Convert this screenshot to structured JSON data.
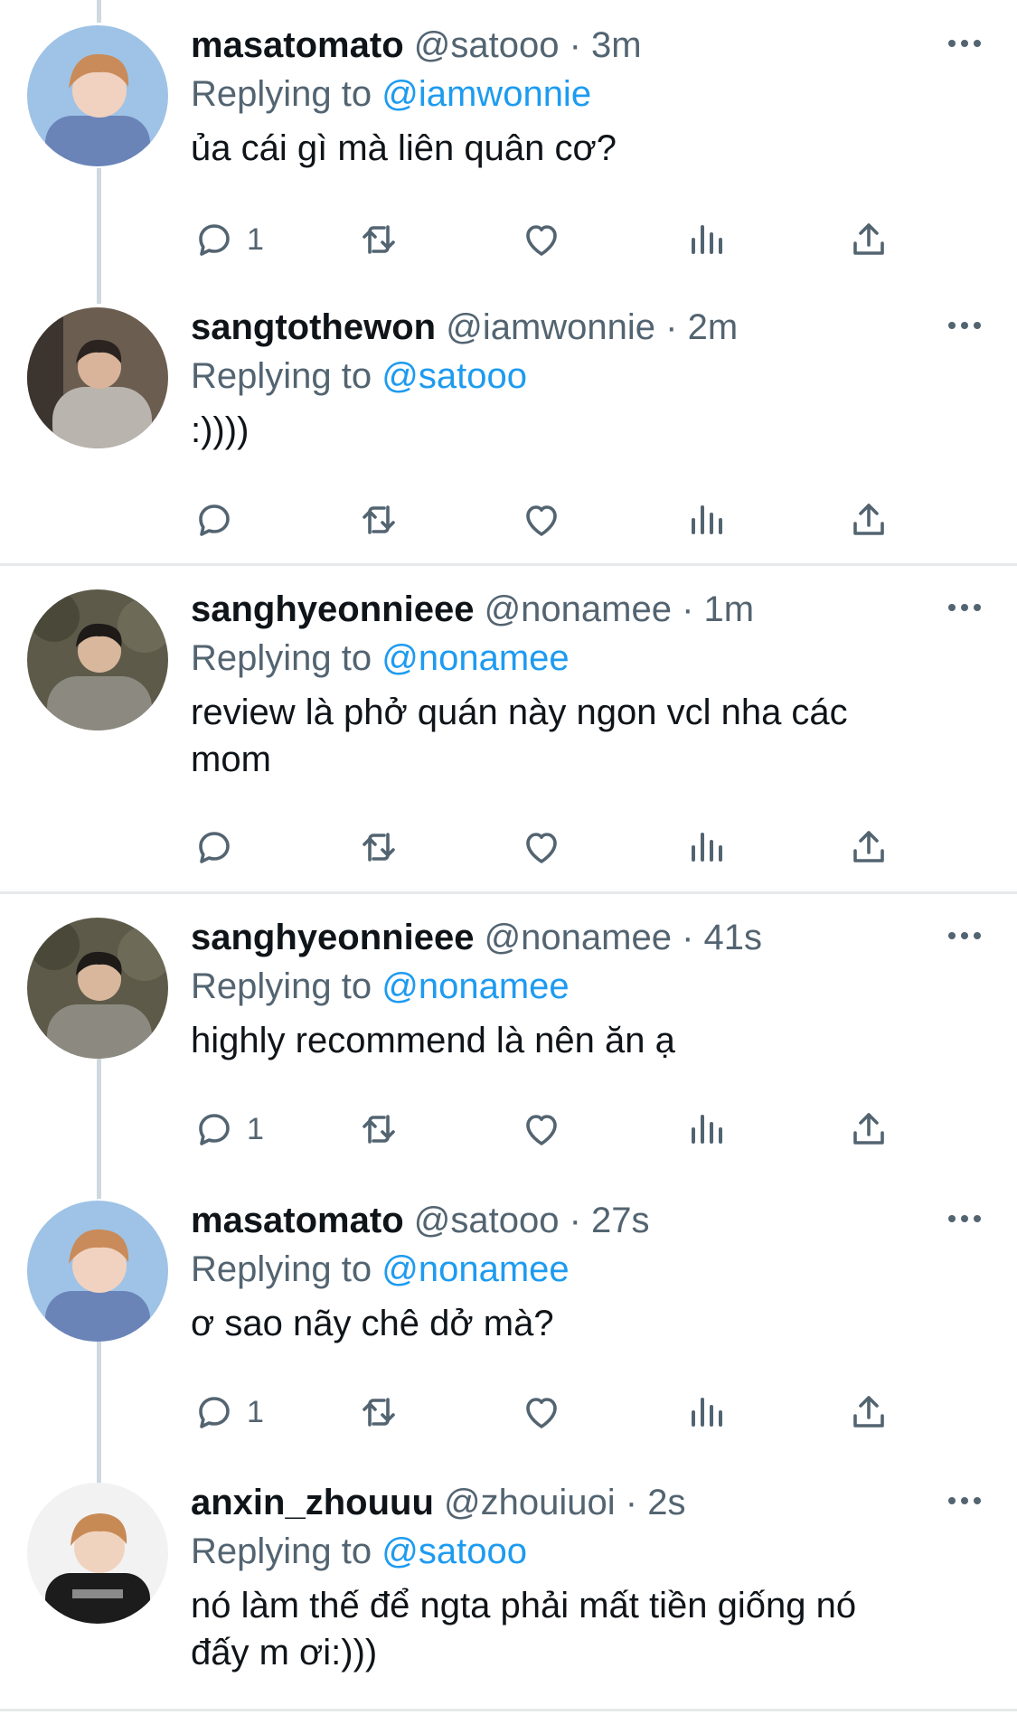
{
  "tweets": [
    {
      "name": "masatomato",
      "handle": "@satooo",
      "time": "3m",
      "replying_label": "Replying to",
      "replying_to": "@iamwonnie",
      "lines": [
        "ủa cái gì mà liên quân cơ?"
      ],
      "reply_count": "1",
      "avatar": {
        "bg": "#9fc3e6",
        "face": "#f1d2c0",
        "hair": "#c98b5a",
        "shirt": "#6a84b8"
      }
    },
    {
      "name": "sangtothewon",
      "handle": "@iamwonnie",
      "time": "2m",
      "replying_label": "Replying to",
      "replying_to": "@satooo",
      "lines": [
        ":))))"
      ],
      "reply_count": "",
      "avatar": {
        "bg": "#6b5d4f",
        "face": "#d9b49a",
        "hair": "#2a2320",
        "shirt": "#b9b4ad"
      }
    },
    {
      "name": "sanghyeonnieee",
      "handle": "@nonamee",
      "time": "1m",
      "replying_label": "Replying to",
      "replying_to": "@nonamee",
      "lines": [
        "review là phở quán này ngon vcl nha các",
        "mom"
      ],
      "reply_count": "",
      "avatar": {
        "bg": "#5d5a49",
        "face": "#d8b79c",
        "hair": "#1d1a18",
        "shirt": "#8c8a80"
      }
    },
    {
      "name": "sanghyeonnieee",
      "handle": "@nonamee",
      "time": "41s",
      "replying_label": "Replying to",
      "replying_to": "@nonamee",
      "lines": [
        "highly recommend là nên ăn ạ"
      ],
      "reply_count": "1",
      "avatar": {
        "bg": "#5d5a49",
        "face": "#d8b79c",
        "hair": "#1d1a18",
        "shirt": "#8c8a80"
      }
    },
    {
      "name": "masatomato",
      "handle": "@satooo",
      "time": "27s",
      "replying_label": "Replying to",
      "replying_to": "@nonamee",
      "lines": [
        "ơ sao nãy chê dở mà?"
      ],
      "reply_count": "1",
      "avatar": {
        "bg": "#9fc3e6",
        "face": "#f1d2c0",
        "hair": "#c98b5a",
        "shirt": "#6a84b8"
      }
    },
    {
      "name": "anxin_zhouuu",
      "handle": "@zhouiuoi",
      "time": "2s",
      "replying_label": "Replying to",
      "replying_to": "@satooo",
      "lines": [
        "nó làm thế để ngta phải mất tiền giống nó",
        "đấy m ơi:)))"
      ],
      "reply_count": "",
      "avatar": {
        "bg": "#f2f2f2",
        "face": "#f0d3bf",
        "hair": "#c88a55",
        "shirt": "#1c1c1c"
      }
    }
  ]
}
